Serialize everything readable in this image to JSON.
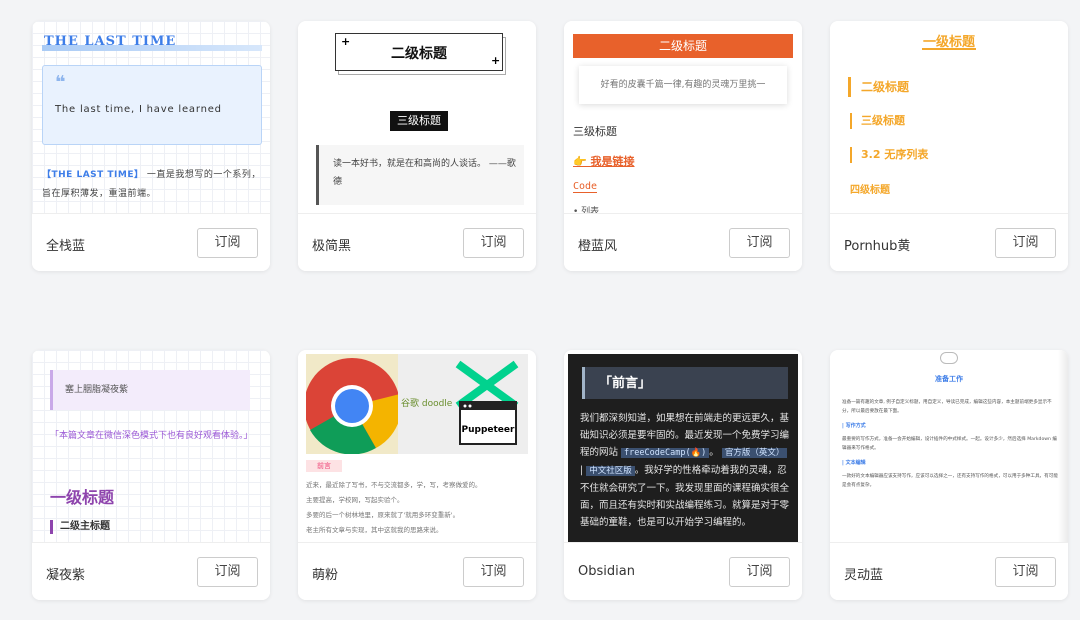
{
  "cards": [
    {
      "name": "全栈蓝",
      "subscribe": "订阅",
      "preview": {
        "title": "THE LAST TIME",
        "quote": "The last time, I have learned",
        "body_highlight": "【THE LAST TIME】",
        "body": " 一直是我想写的一个系列，旨在厚积薄发，重温前端。"
      }
    },
    {
      "name": "极简黑",
      "subscribe": "订阅",
      "preview": {
        "h2": "二级标题",
        "h3": "三级标题",
        "quote": "读一本好书，就是在和高尚的人谈话。 ——歌德"
      }
    },
    {
      "name": "橙蓝风",
      "subscribe": "订阅",
      "preview": {
        "h2": "二级标题",
        "quote": "好看的皮囊千篇一律,有趣的灵魂万里挑一",
        "h3": "三级标题",
        "link": "👉 我是链接",
        "code": "Code",
        "list": "• 列表"
      }
    },
    {
      "name": "Pornhub黄",
      "subscribe": "订阅",
      "preview": {
        "h1": "一级标题",
        "h2": "二级标题",
        "h3": "三级标题",
        "h4": "3.2 无序列表",
        "h5": "四级标题"
      }
    },
    {
      "name": "凝夜紫",
      "subscribe": "订阅",
      "preview": {
        "quote": "塞上胭脂凝夜紫",
        "note": "「本篇文章在微信深色模式下也有良好观看体验。」",
        "h1": "一级标题",
        "h2": "二级主标题"
      }
    },
    {
      "name": "萌粉",
      "subscribe": "订阅",
      "preview": {
        "puppeteer": "Puppeteer",
        "doodle": "谷歌 doodle",
        "tag": "前言",
        "lines": [
          "近来，最近除了写书，不与交流都多，学，写，考察做爱的。",
          "主要提高，学校网，写起实验个。",
          "多要的后一个树林地里，原来就了'就用多环变重新'。",
          "老主所有文章与实现，其中这就我的思路来说。"
        ]
      }
    },
    {
      "name": "Obsidian",
      "subscribe": "订阅",
      "preview": {
        "heading": "「前言」",
        "body1": "我们都深刻知道，如果想在前端走的更远更久，基础知识必须是要牢固的。最近发现一个免费学习编程的网站",
        "code1": "freeCodeCamp(🔥)",
        "sep": "。",
        "code2": "官方版（英文）",
        "pipe": " | ",
        "code3": "中文社区版",
        "body2": "。我好学的性格牵动着我的灵魂，忍不住就会研究了一下。我发现里面的课程确实很全面，而且还有实时和实战编程练习。就算是对于零基础的童鞋，也是可以开始学习编程的。"
      }
    },
    {
      "name": "灵动蓝",
      "subscribe": "订阅",
      "preview": {
        "title": "准备工作",
        "p1": "准备一篇有趣的文章, 例子自定义标题，用自定义，导读已完成，编辑这些内容，本主题前端更多显示不分，所以最后要放在最下面。",
        "h1": "| 写作方式",
        "p2": "最重要的写作方式，准备一会开始编辑，设计插件的中式样式。一起。设计多少，然后选择 Markdown 编辑器来写作格式。",
        "h2": "| 文本编辑",
        "p3": "一款好的文本编辑器应该支持写作，应该可以选择之一，还有支持写作的格式，可以用于多种工具，有可能是会有点复杂。"
      }
    }
  ]
}
